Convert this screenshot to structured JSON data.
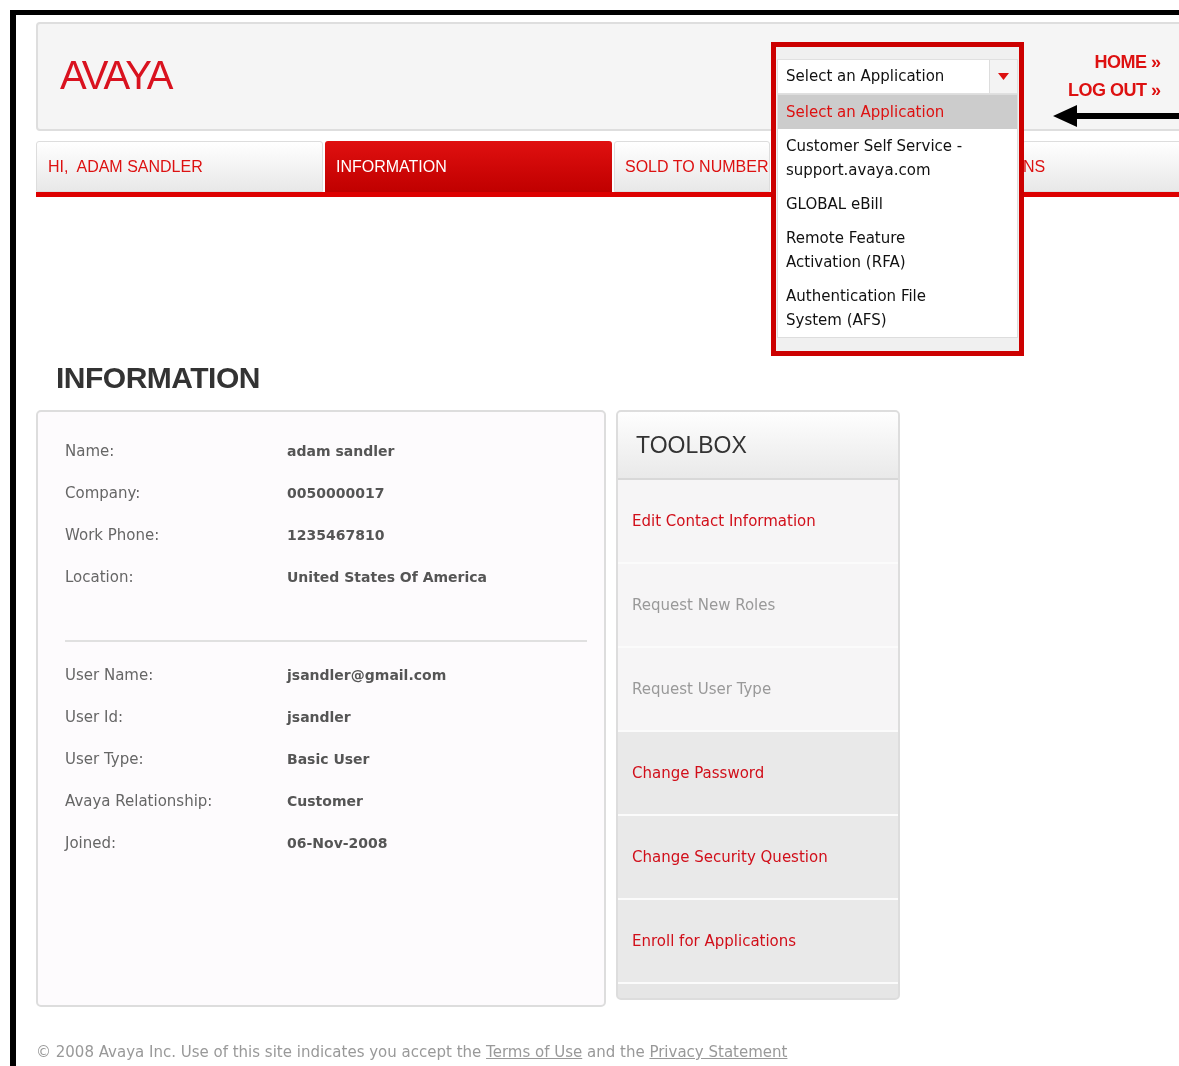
{
  "header": {
    "logo": "AVAYA",
    "links": [
      {
        "label": "HOME »"
      },
      {
        "label": "LOG OUT »"
      }
    ]
  },
  "app_select": {
    "value": "Select an Application",
    "expanded": true,
    "options": [
      {
        "label": "Select an Application",
        "selected": true
      },
      {
        "label": "Customer Self Service - support.avaya.com",
        "selected": false
      },
      {
        "label": "GLOBAL eBill",
        "selected": false
      },
      {
        "label": "Remote Feature Activation (RFA)",
        "selected": false
      },
      {
        "label": "Authentication File System (AFS)",
        "selected": false
      }
    ]
  },
  "tabs": [
    {
      "label": "HI,  ADAM SANDLER",
      "selected": false
    },
    {
      "label": "INFORMATION",
      "selected": true
    },
    {
      "label": "SOLD TO NUMBER",
      "selected": false
    },
    {
      "label": "NS",
      "selected": false
    }
  ],
  "page_title": "INFORMATION",
  "info": {
    "groups": [
      [
        {
          "label": "Name:",
          "value": "adam sandler"
        },
        {
          "label": "Company:",
          "value": "0050000017"
        },
        {
          "label": "Work Phone:",
          "value": "1235467810"
        },
        {
          "label": "Location:",
          "value": "United States Of America"
        }
      ],
      [
        {
          "label": "User Name:",
          "value": "jsandler@gmail.com"
        },
        {
          "label": "User Id:",
          "value": "jsandler"
        },
        {
          "label": "User Type:",
          "value": "Basic User"
        },
        {
          "label": "Avaya Relationship:",
          "value": "Customer"
        },
        {
          "label": "Joined:",
          "value": "06-Nov-2008"
        }
      ]
    ]
  },
  "toolbox": {
    "title": "TOOLBOX",
    "items": [
      {
        "label": "Edit Contact Information",
        "disabled": false
      },
      {
        "label": "Request New Roles",
        "disabled": true
      },
      {
        "label": "Request User Type",
        "disabled": true
      },
      {
        "label": "Change Password",
        "disabled": false
      },
      {
        "label": "Change Security Question",
        "disabled": false
      },
      {
        "label": "Enroll for Applications",
        "disabled": false
      }
    ]
  },
  "footer": {
    "text_1": "© 2008 Avaya Inc. Use of this site indicates you accept the",
    "link_1": "Terms of Use",
    "text_2": "and the",
    "link_2": "Privacy Statement"
  }
}
